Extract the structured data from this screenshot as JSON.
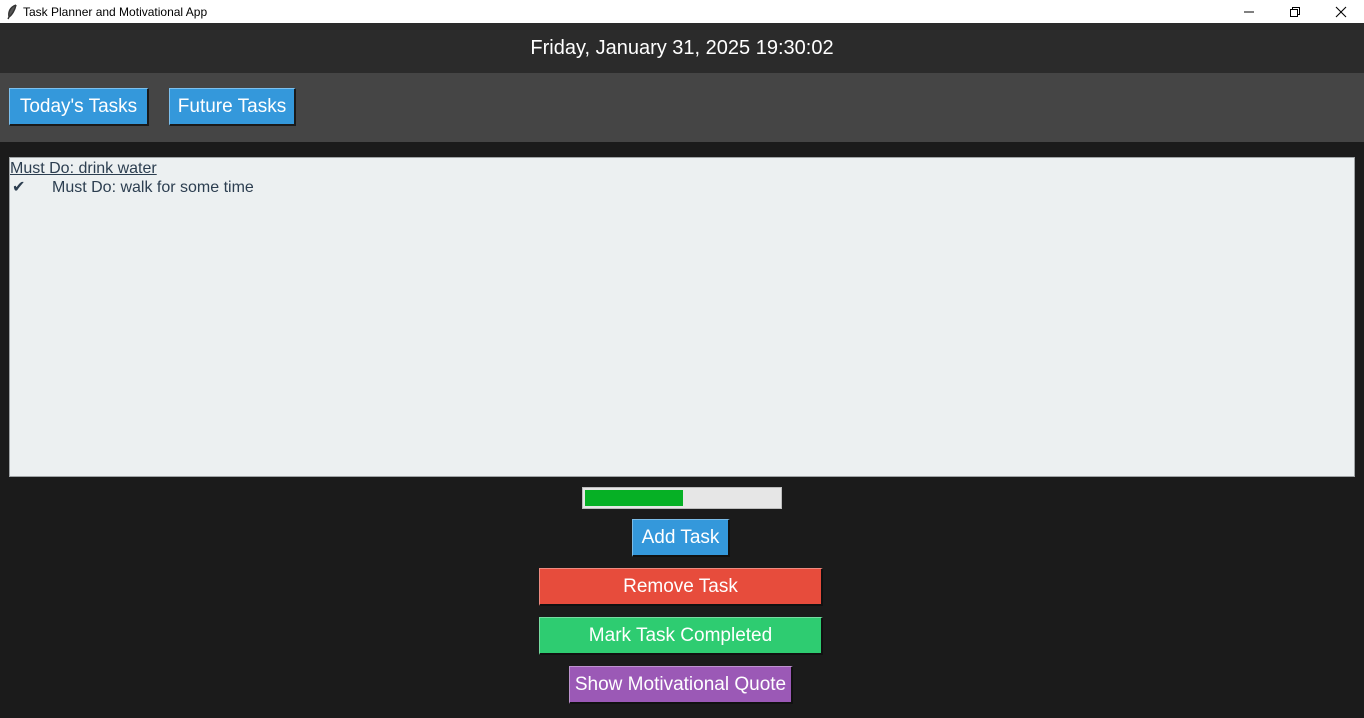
{
  "window": {
    "title": "Task Planner and Motivational App",
    "app_icon": "feather-icon",
    "controls": [
      "minimize-icon",
      "restore-icon",
      "close-icon"
    ]
  },
  "header": {
    "datetime": "Friday, January 31, 2025 19:30:02"
  },
  "tabs": [
    {
      "label": "Today's Tasks"
    },
    {
      "label": "Future Tasks"
    }
  ],
  "tasks": [
    {
      "text": "Must Do: drink water",
      "completed": false,
      "selected": true
    },
    {
      "text": "Must Do: walk for some time",
      "completed": true,
      "selected": false,
      "check": "✔"
    }
  ],
  "progress": {
    "fraction": 0.5
  },
  "actions": {
    "add_label": "Add Task",
    "remove_label": "Remove Task",
    "complete_label": "Mark Task Completed",
    "quote_label": "Show Motivational Quote"
  },
  "colors": {
    "header_bg": "#2b2b2b",
    "tabbar_bg": "#454545",
    "body_bg": "#1b1b1b",
    "list_bg": "#ecf0f1",
    "blue": "#3498db",
    "red": "#e74c3c",
    "green": "#2ecc71",
    "purple": "#8e44ad",
    "progress": "#06b025"
  }
}
